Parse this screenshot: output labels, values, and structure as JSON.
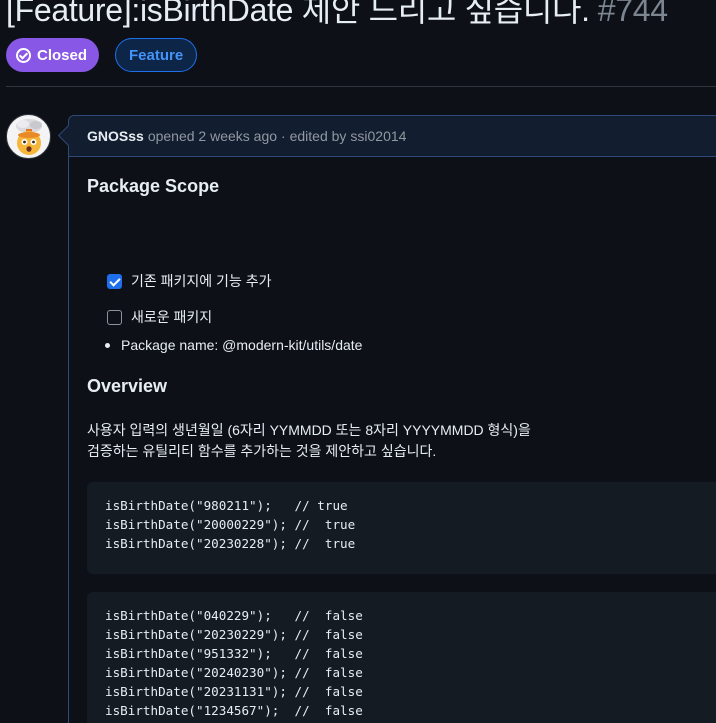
{
  "issue": {
    "title": "[Feature]:isBirthDate 제안 드리고 싶습니다.",
    "number": "#744",
    "state_label": "Closed",
    "labels": [
      "Feature"
    ]
  },
  "comment": {
    "author": "GNOSss",
    "opened_text": "opened 2 weeks ago",
    "edited_text": "· edited by",
    "editor": "ssi02014"
  },
  "package_scope": {
    "heading": "Package Scope",
    "tasks": [
      {
        "label": "기존 패키지에 기능 추가",
        "checked": true
      },
      {
        "label": "새로운 패키지",
        "checked": false
      }
    ],
    "bullet": "Package name: @modern-kit/utils/date"
  },
  "overview": {
    "heading": "Overview",
    "lines": [
      "사용자 입력의 생년월일 (6자리 YYMMDD 또는 8자리 YYYYMMDD 형식)을",
      "검증하는 유틸리티 함수를 추가하는 것을 제안하고 싶습니다."
    ],
    "code_block_1": "isBirthDate(\"980211\");   // true\nisBirthDate(\"20000229\"); //  true\nisBirthDate(\"20230228\"); //  true",
    "code_block_2": "isBirthDate(\"040229\");   //  false\nisBirthDate(\"20230229\"); //  false\nisBirthDate(\"951332\");   //  false\nisBirthDate(\"20240230\"); //  false\nisBirthDate(\"20231131\"); //  false\nisBirthDate(\"1234567\");  //  false"
  },
  "colors": {
    "closed_badge": "#8957e5",
    "feature_label": "#4493f8",
    "background": "#0d1117"
  }
}
